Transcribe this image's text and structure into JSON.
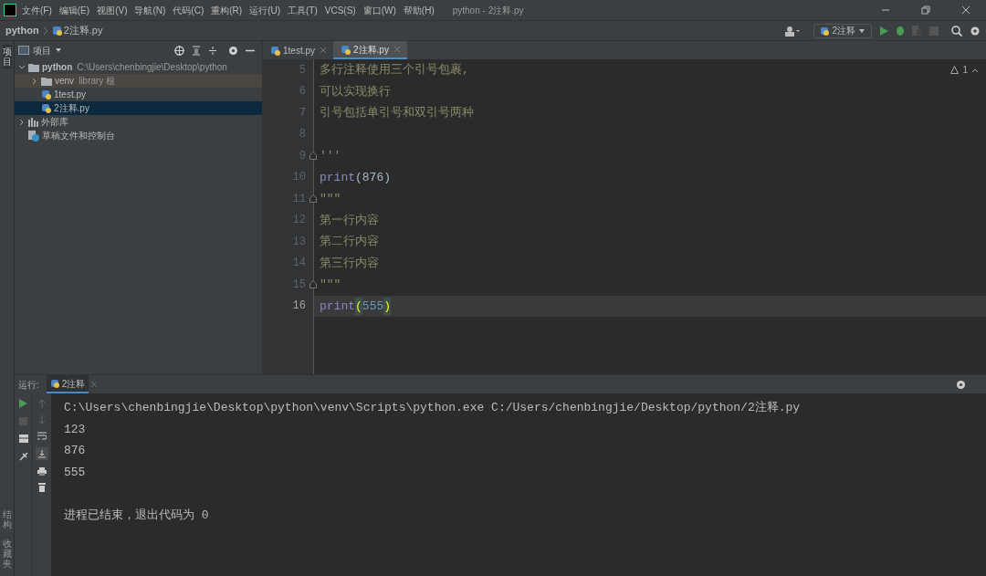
{
  "menu": [
    "文件(F)",
    "编辑(E)",
    "视图(V)",
    "导航(N)",
    "代码(C)",
    "重构(R)",
    "运行(U)",
    "工具(T)",
    "VCS(S)",
    "窗口(W)",
    "帮助(H)"
  ],
  "window": {
    "title": "python - 2注释.py"
  },
  "breadcrumb": [
    "python",
    "2注释.py"
  ],
  "run_config": {
    "label": "2注释"
  },
  "left_stripe": [
    "项目",
    "结构",
    "收藏夹"
  ],
  "project_panel": {
    "title": "项目",
    "tree": [
      {
        "label": "python",
        "note": "C:\\Users\\chenbingjie\\Desktop\\python",
        "kind": "folder",
        "expanded": true,
        "selected": false,
        "children": [
          {
            "label": "venv",
            "note": "library 根",
            "kind": "folder",
            "expanded": false,
            "selected": false
          },
          {
            "label": "1test.py",
            "kind": "python",
            "selected": false
          },
          {
            "label": "2注释.py",
            "kind": "python",
            "selected": true
          }
        ]
      },
      {
        "label": "外部库",
        "kind": "library",
        "expanded": false,
        "selected": false
      },
      {
        "label": "草稿文件和控制台",
        "kind": "scratch",
        "selected": false
      }
    ]
  },
  "editor_tabs": [
    {
      "label": "1test.py",
      "selected": false
    },
    {
      "label": "2注释.py",
      "selected": true
    }
  ],
  "inspection": {
    "count": "1"
  },
  "code_lines": [
    {
      "number": "5",
      "current": false,
      "tokens": [
        {
          "text": "多行注释使用三个引号包裹,",
          "kind": "doc"
        }
      ]
    },
    {
      "number": "6",
      "current": false,
      "tokens": [
        {
          "text": "可以实现换行",
          "kind": "doc"
        }
      ]
    },
    {
      "number": "7",
      "current": false,
      "tokens": [
        {
          "text": "引号包括单引号和双引号两种",
          "kind": "doc"
        }
      ]
    },
    {
      "number": "8",
      "current": false
    },
    {
      "number": "9",
      "current": false,
      "fold": true,
      "tokens": [
        {
          "text": "'''",
          "kind": "doc"
        }
      ]
    },
    {
      "number": "10",
      "current": false,
      "tokens": [
        {
          "text": "print",
          "kind": "builtin"
        },
        {
          "text": "(876)",
          "kind": "plain"
        }
      ]
    },
    {
      "number": "11",
      "current": false,
      "fold": true,
      "tokens": [
        {
          "text": "\"\"\"",
          "kind": "doc"
        }
      ]
    },
    {
      "number": "12",
      "current": false,
      "tokens": [
        {
          "text": "第一行内容",
          "kind": "doc"
        }
      ]
    },
    {
      "number": "13",
      "current": false,
      "tokens": [
        {
          "text": "第二行内容",
          "kind": "doc"
        }
      ]
    },
    {
      "number": "14",
      "current": false,
      "tokens": [
        {
          "text": "第三行内容",
          "kind": "doc"
        }
      ]
    },
    {
      "number": "15",
      "current": false,
      "fold": true,
      "tokens": [
        {
          "text": "\"\"\"",
          "kind": "doc"
        }
      ]
    },
    {
      "number": "16",
      "current": true,
      "tokens": [
        {
          "text": "print",
          "kind": "builtin"
        },
        {
          "text": "(",
          "kind": "brace"
        },
        {
          "text": "555",
          "kind": "number"
        },
        {
          "text": ")",
          "kind": "brace"
        }
      ]
    }
  ],
  "run_panel": {
    "label": "运行:",
    "tab": "2注释",
    "console": [
      {
        "text": "C:\\Users\\chenbingjie\\Desktop\\python\\venv\\Scripts\\python.exe C:/Users/chenbingjie/Desktop/python/2注释.py",
        "kind": "output"
      },
      {
        "text": "123",
        "kind": "output"
      },
      {
        "text": "876",
        "kind": "output"
      },
      {
        "text": "555",
        "kind": "output"
      },
      {
        "text": "进程已结束，退出代码为 0",
        "kind": "status"
      }
    ]
  }
}
